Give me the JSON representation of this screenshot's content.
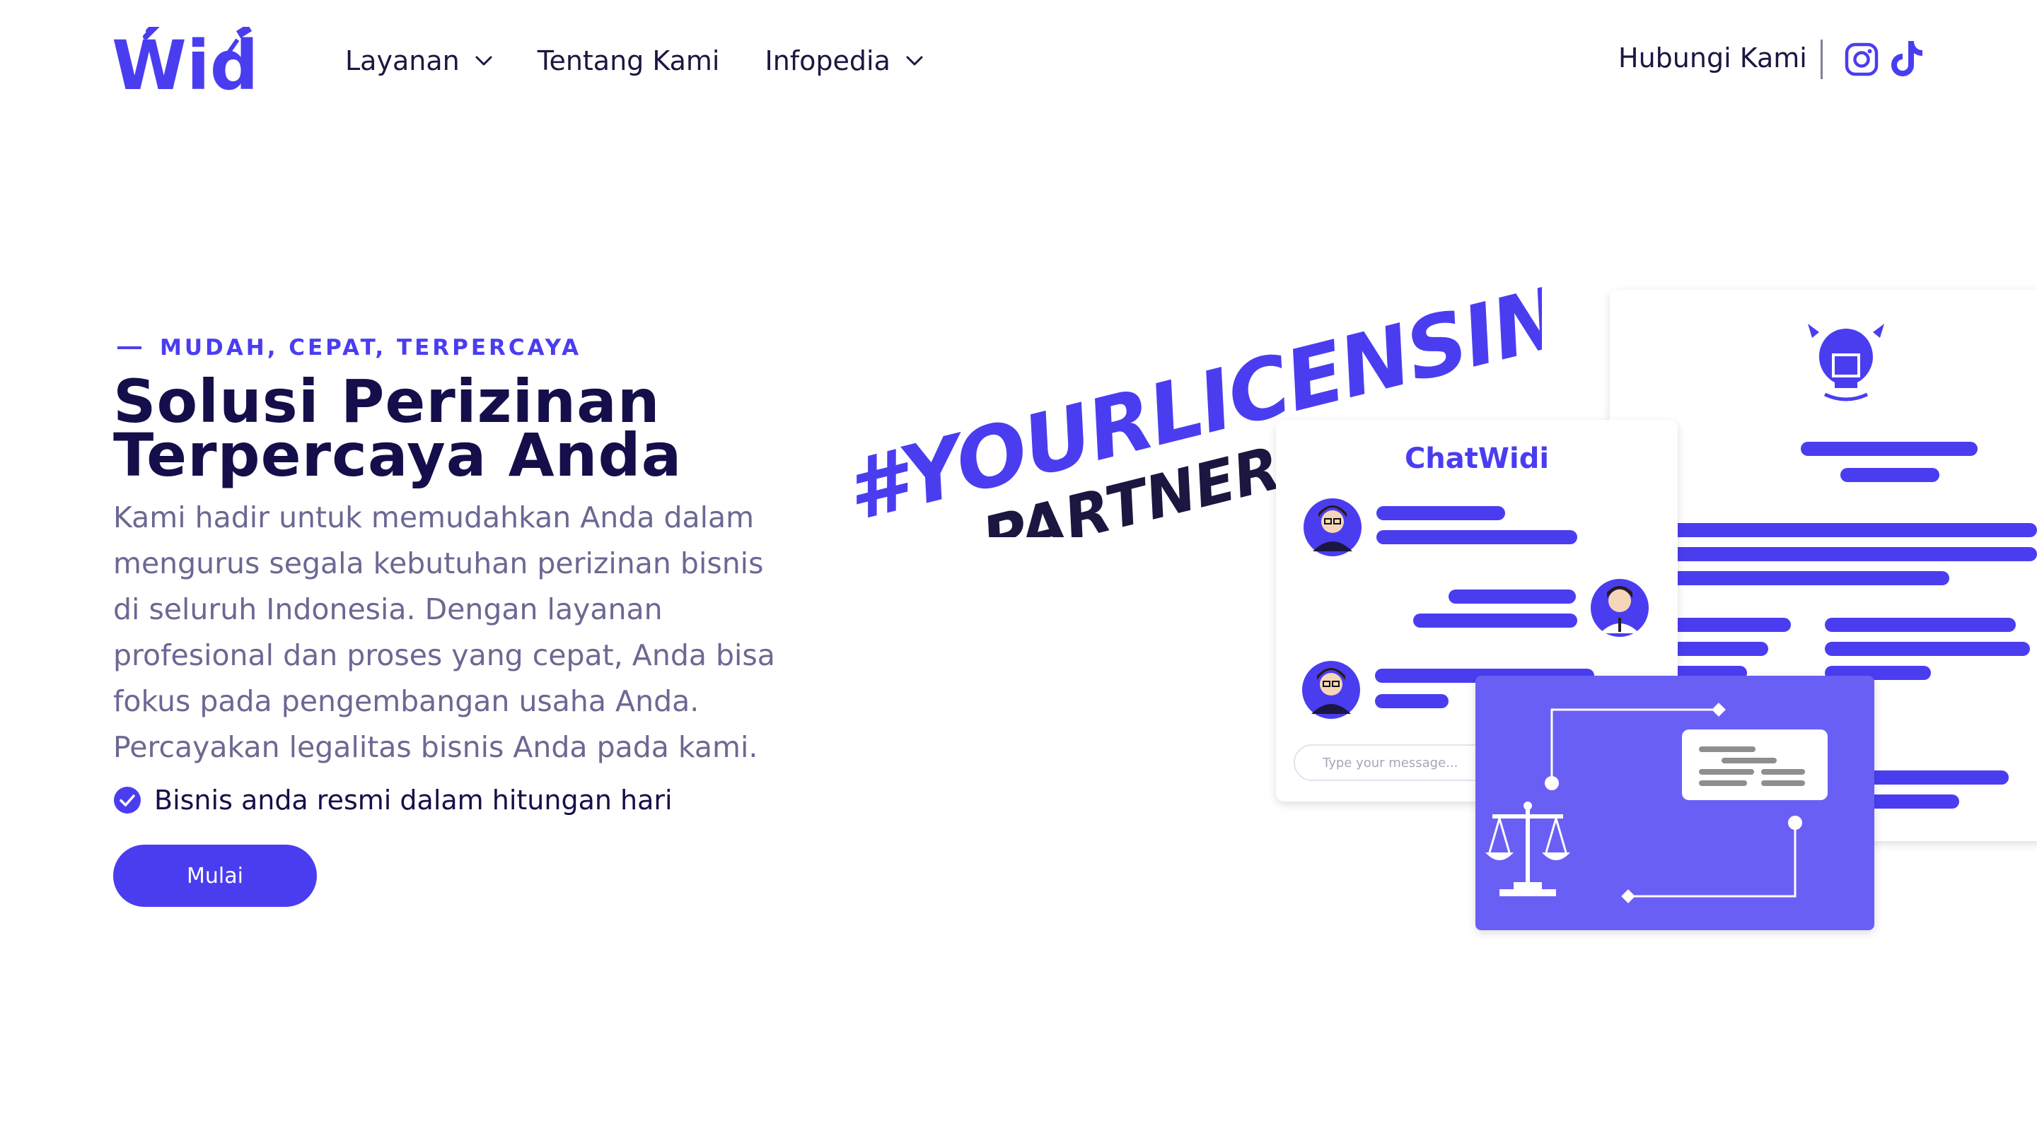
{
  "header": {
    "logo_text": "Widi",
    "nav": [
      {
        "label": "Layanan",
        "has_dropdown": true
      },
      {
        "label": "Tentang Kami",
        "has_dropdown": false
      },
      {
        "label": "Infopedia",
        "has_dropdown": true
      }
    ],
    "contact_label": "Hubungi Kami",
    "social": [
      "instagram-icon",
      "tiktok-icon"
    ]
  },
  "hero": {
    "eyebrow": "MUDAH, CEPAT, TERPERCAYA",
    "title_line1": "Solusi Perizinan",
    "title_line2": "Terpercaya Anda",
    "description": "Kami hadir untuk memudahkan Anda dalam mengurus segala kebutuhan perizinan bisnis di seluruh Indonesia. Dengan layanan profesional dan proses yang cepat, Anda bisa fokus pada pengembangan usaha Anda. Percayakan legalitas bisnis Anda pada kami.",
    "check_text": "Bisnis anda resmi dalam hitungan hari",
    "cta_label": "Mulai"
  },
  "illustration": {
    "slogan_line1": "#YOURLICENSING",
    "slogan_line2": "PARTNER",
    "chat_title": "ChatWidi",
    "chat_placeholder": "Type your message..."
  },
  "colors": {
    "accent": "#4a3df0",
    "accent_light": "#6a5ff5",
    "title": "#140f4a",
    "body": "#6b6893"
  }
}
